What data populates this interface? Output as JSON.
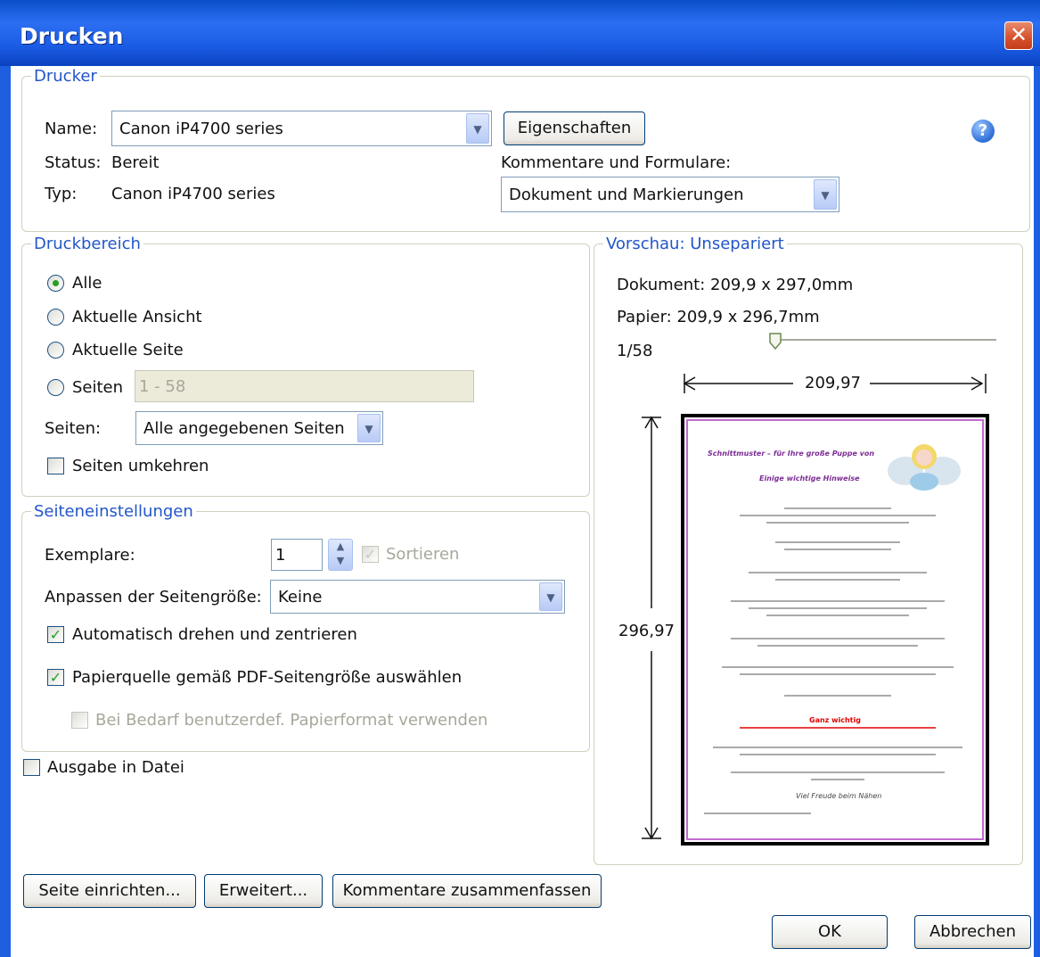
{
  "window": {
    "title": "Drucken",
    "close_glyph": "✕"
  },
  "printer": {
    "legend": "Drucker",
    "name_label": "Name:",
    "name_value": "Canon iP4700 series",
    "properties_button": "Eigenschaften",
    "status_label": "Status:",
    "status_value": "Bereit",
    "type_label": "Typ:",
    "type_value": "Canon iP4700 series",
    "comments_label": "Kommentare und Formulare:",
    "comments_value": "Dokument und Markierungen",
    "help_glyph": "?"
  },
  "print_range": {
    "legend": "Druckbereich",
    "all": "Alle",
    "current_view": "Aktuelle Ansicht",
    "current_page": "Aktuelle Seite",
    "pages": "Seiten",
    "pages_value": "1 - 58",
    "subset_label": "Seiten:",
    "subset_value": "Alle angegebenen Seiten",
    "reverse": "Seiten umkehren",
    "selected": "Alle"
  },
  "page_setup": {
    "legend": "Seiteneinstellungen",
    "copies_label": "Exemplare:",
    "copies_value": "1",
    "collate": "Sortieren",
    "scaling_label": "Anpassen der Seitengröße:",
    "scaling_value": "Keine",
    "auto_rotate": "Automatisch drehen und zentrieren",
    "paper_source": "Papierquelle gemäß PDF-Seitengröße auswählen",
    "custom_paper": "Bei Bedarf benutzerdef. Papierformat verwenden"
  },
  "output_to_file": "Ausgabe in Datei",
  "preview": {
    "legend": "Vorschau: Unsepariert",
    "document": "Dokument: 209,9 x 297,0mm",
    "paper": "Papier: 209,9 x 296,7mm",
    "page_indicator": "1/58",
    "slider_position": 0.0,
    "width_dim": "209,97",
    "height_dim": "296,97",
    "doc_heading": "Schnittmuster – für Ihre große Puppe von",
    "doc_subheading": "Einige wichtige Hinweise",
    "doc_warning": "Ganz wichtig",
    "doc_closing": "Viel Freude beim Nähen"
  },
  "buttons": {
    "page_setup": "Seite einrichten...",
    "advanced": "Erweitert...",
    "summarize_comments": "Kommentare zusammenfassen",
    "ok": "OK",
    "cancel": "Abbrechen"
  },
  "icons": {
    "help": "help-icon",
    "close": "close-icon",
    "dropdown": "chevron-down-icon",
    "spinner": "spinner-icon"
  },
  "colors": {
    "titlebar": "#0a4fc9",
    "legend_text": "#2256c8",
    "check_mark": "#21a121",
    "close_button": "#d9532d",
    "preview_border": "#000000",
    "doc_heading": "#7b2d94",
    "doc_warning": "#e00000"
  }
}
